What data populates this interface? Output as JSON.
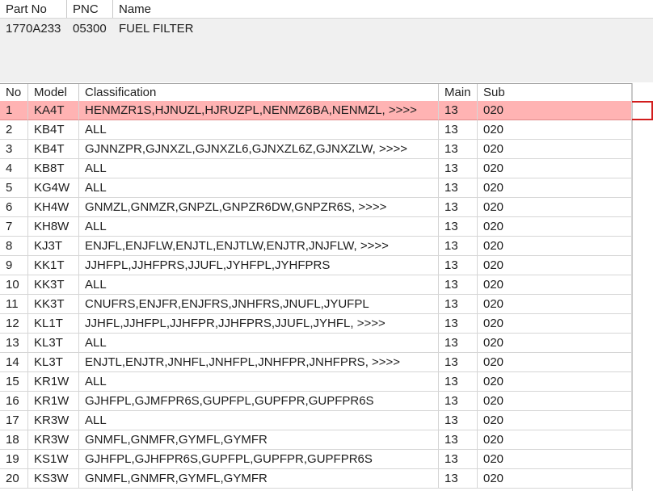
{
  "part_header": {
    "col_part_no": "Part No",
    "col_pnc": "PNC",
    "col_name": "Name"
  },
  "part_info": {
    "part_no": "1770A233",
    "pnc": "05300",
    "name": "FUEL FILTER"
  },
  "grid_header": {
    "no": "No",
    "model": "Model",
    "classification": "Classification",
    "main": "Main",
    "sub": "Sub"
  },
  "selected_row": 0,
  "rows": [
    {
      "no": "1",
      "model": "KA4T",
      "classification": "HENMZR1S,HJNUZL,HJRUZPL,NENMZ6BA,NENMZL,  >>>>",
      "main": "13",
      "sub": "020"
    },
    {
      "no": "2",
      "model": "KB4T",
      "classification": "ALL",
      "main": "13",
      "sub": "020"
    },
    {
      "no": "3",
      "model": "KB4T",
      "classification": "GJNNZPR,GJNXZL,GJNXZL6,GJNXZL6Z,GJNXZLW,  >>>>",
      "main": "13",
      "sub": "020"
    },
    {
      "no": "4",
      "model": "KB8T",
      "classification": "ALL",
      "main": "13",
      "sub": "020"
    },
    {
      "no": "5",
      "model": "KG4W",
      "classification": "ALL",
      "main": "13",
      "sub": "020"
    },
    {
      "no": "6",
      "model": "KH4W",
      "classification": "GNMZL,GNMZR,GNPZL,GNPZR6DW,GNPZR6S,  >>>>",
      "main": "13",
      "sub": "020"
    },
    {
      "no": "7",
      "model": "KH8W",
      "classification": "ALL",
      "main": "13",
      "sub": "020"
    },
    {
      "no": "8",
      "model": "KJ3T",
      "classification": "ENJFL,ENJFLW,ENJTL,ENJTLW,ENJTR,JNJFLW,  >>>>",
      "main": "13",
      "sub": "020"
    },
    {
      "no": "9",
      "model": "KK1T",
      "classification": "JJHFPL,JJHFPRS,JJUFL,JYHFPL,JYHFPRS",
      "main": "13",
      "sub": "020"
    },
    {
      "no": "10",
      "model": "KK3T",
      "classification": "ALL",
      "main": "13",
      "sub": "020"
    },
    {
      "no": "11",
      "model": "KK3T",
      "classification": "CNUFRS,ENJFR,ENJFRS,JNHFRS,JNUFL,JYUFPL",
      "main": "13",
      "sub": "020"
    },
    {
      "no": "12",
      "model": "KL1T",
      "classification": "JJHFL,JJHFPL,JJHFPR,JJHFPRS,JJUFL,JYHFL,  >>>>",
      "main": "13",
      "sub": "020"
    },
    {
      "no": "13",
      "model": "KL3T",
      "classification": "ALL",
      "main": "13",
      "sub": "020"
    },
    {
      "no": "14",
      "model": "KL3T",
      "classification": "ENJTL,ENJTR,JNHFL,JNHFPL,JNHFPR,JNHFPRS,  >>>>",
      "main": "13",
      "sub": "020"
    },
    {
      "no": "15",
      "model": "KR1W",
      "classification": "ALL",
      "main": "13",
      "sub": "020"
    },
    {
      "no": "16",
      "model": "KR1W",
      "classification": "GJHFPL,GJMFPR6S,GUPFPL,GUPFPR,GUPFPR6S",
      "main": "13",
      "sub": "020"
    },
    {
      "no": "17",
      "model": "KR3W",
      "classification": "ALL",
      "main": "13",
      "sub": "020"
    },
    {
      "no": "18",
      "model": "KR3W",
      "classification": "GNMFL,GNMFR,GYMFL,GYMFR",
      "main": "13",
      "sub": "020"
    },
    {
      "no": "19",
      "model": "KS1W",
      "classification": "GJHFPL,GJHFPR6S,GUPFPL,GUPFPR,GUPFPR6S",
      "main": "13",
      "sub": "020"
    },
    {
      "no": "20",
      "model": "KS3W",
      "classification": "GNMFL,GNMFR,GYMFL,GYMFR",
      "main": "13",
      "sub": "020"
    }
  ]
}
